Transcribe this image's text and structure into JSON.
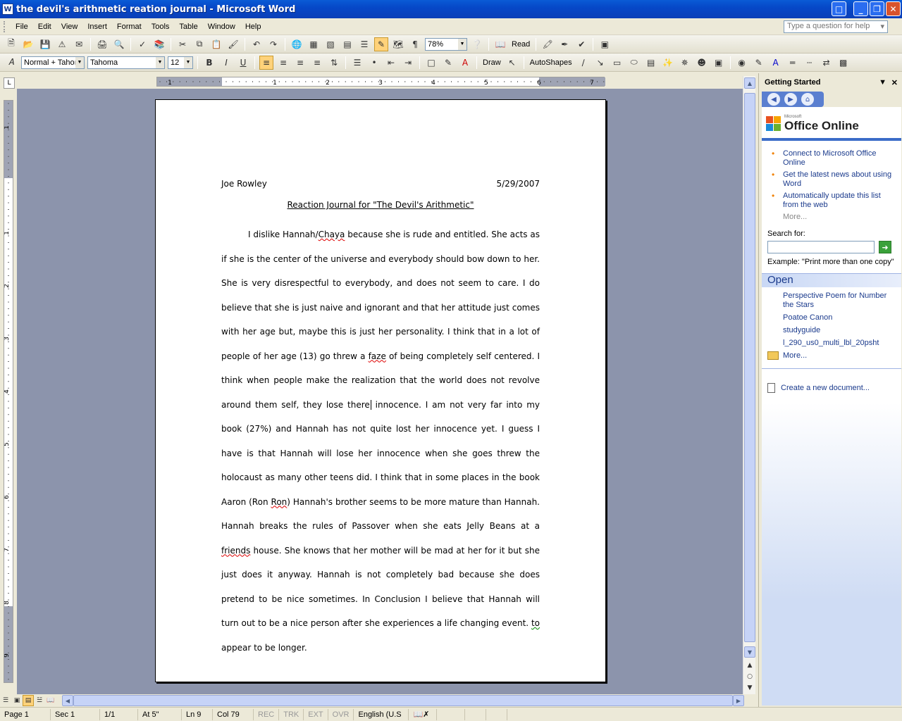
{
  "window": {
    "title": "the devil's arithmetic reation journal - Microsoft Word",
    "app_icon": "W",
    "colors": {
      "titlebar": "#0a5bd6",
      "accent": "#3a6cc8"
    }
  },
  "menu": {
    "items": [
      "File",
      "Edit",
      "View",
      "Insert",
      "Format",
      "Tools",
      "Table",
      "Window",
      "Help"
    ],
    "help_placeholder": "Type a question for help"
  },
  "toolbar_standard": {
    "zoom": "78%",
    "read_label": "Read"
  },
  "toolbar_formatting": {
    "style": "Normal + Tahoı",
    "font": "Tahoma",
    "size": "12",
    "bold": "B",
    "italic": "I",
    "underline": "U",
    "draw_label": "Draw",
    "autoshapes_label": "AutoShapes"
  },
  "ruler": {
    "h_labels": [
      "1",
      "1",
      "2",
      "3",
      "4",
      "5",
      "6",
      "7"
    ],
    "v_labels": [
      "1",
      "1",
      "2",
      "3",
      "4",
      "5",
      "6",
      "7",
      "8",
      "9"
    ]
  },
  "document": {
    "author": "Joe Rowley",
    "date": "5/29/2007",
    "title": "Reaction Journal for \"The Devil's Arithmetic\"",
    "body_parts": [
      "I dislike Hannah/",
      "Chaya",
      " because she is rude and entitled. She acts as if she is the center of the universe and everybody should bow down to her. She is very disrespectful to everybody, and does not seem to care. I do believe that she is just naive and ignorant and that her attitude just comes with her age but, maybe this is just her personality. I think that in a lot of people of her age (13) go threw a ",
      "faze",
      " of being completely self centered. I think when people make the realization that the world does not revolve around them self, they lose there",
      " innocence. I am not very far into my book (27%) and Hannah has not quite lost her innocence yet. I guess I have is that Hannah will lose her innocence when she goes threw the holocaust as many other teens did. I think that in some places in the book Aaron (Ron ",
      "Ron",
      ") Hannah's brother seems to be more mature than Hannah. Hannah breaks the rules of Passover when she eats Jelly Beans at a ",
      "friends",
      " house. She knows that her mother will be mad at her for it but she just does it anyway. Hannah is not completely bad because she does pretend to be nice sometimes. In Conclusion I believe that Hannah will turn out to be a nice person after she experiences a life changing event. ",
      "to",
      " appear to be longer."
    ]
  },
  "taskpane": {
    "title": "Getting Started",
    "logo_small": "Microsoft",
    "logo_text": "Office Online",
    "links": [
      "Connect to Microsoft Office Online",
      "Get the latest news about using Word",
      "Automatically update this list from the web"
    ],
    "more": "More...",
    "search_label": "Search for:",
    "example": "Example:  \"Print more than one copy\"",
    "open_heading": "Open",
    "open_files": [
      "Perspective Poem for Number the Stars",
      "Poatoe Canon",
      "studyguide",
      "l_290_us0_multi_lbl_20psht"
    ],
    "open_more": "More...",
    "create_new": "Create a new document..."
  },
  "status": {
    "page": "Page 1",
    "sec": "Sec 1",
    "pages": "1/1",
    "at": "At 5\"",
    "ln": "Ln 9",
    "col": "Col 79",
    "rec": "REC",
    "trk": "TRK",
    "ext": "EXT",
    "ovr": "OVR",
    "lang": "English (U.S"
  }
}
